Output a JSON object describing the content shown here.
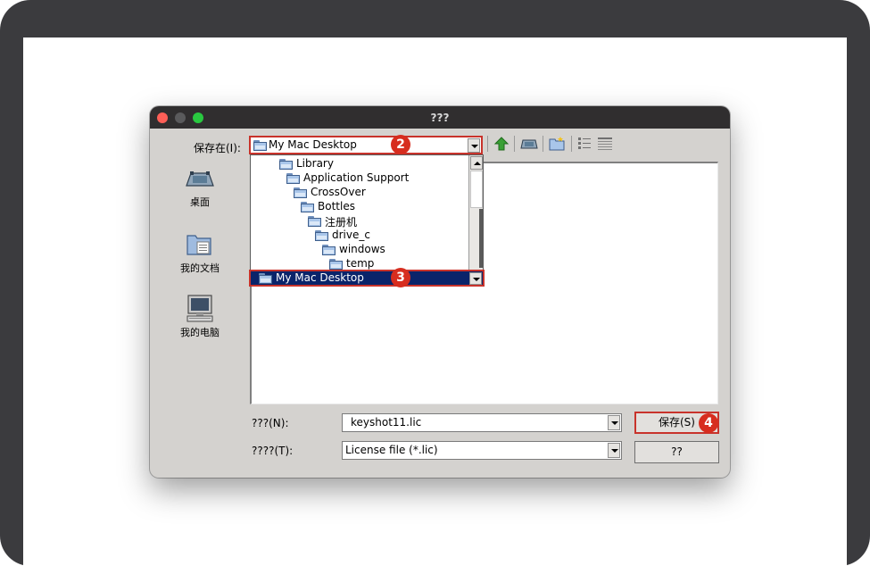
{
  "window": {
    "title": "???"
  },
  "save_in": {
    "label": "保存在(I):",
    "value": "My Mac Desktop"
  },
  "places": [
    {
      "name": "desktop",
      "label": "桌面"
    },
    {
      "name": "my-documents",
      "label": "我的文档"
    },
    {
      "name": "my-computer",
      "label": "我的电脑"
    }
  ],
  "folder_tree": [
    "Library",
    "Application Support",
    "CrossOver",
    "Bottles",
    "注册机",
    "drive_c",
    "windows",
    "temp"
  ],
  "selected_folder": "My Mac Desktop",
  "filename": {
    "label": "???(N):",
    "value": "keyshot11.lic"
  },
  "filetype": {
    "label": "????(T):",
    "value": "License file (*.lic)"
  },
  "buttons": {
    "save": "保存(S)",
    "cancel": "??"
  },
  "toolbar_icons": [
    "up-folder-icon",
    "desktop-icon",
    "new-folder-icon",
    "list-view-icon",
    "details-view-icon"
  ],
  "badges": {
    "combo": "2",
    "selection": "3",
    "save": "4"
  },
  "colors": {
    "selection": "#0a246a",
    "highlight_border": "#c8332b",
    "badge": "#d72d1f"
  }
}
